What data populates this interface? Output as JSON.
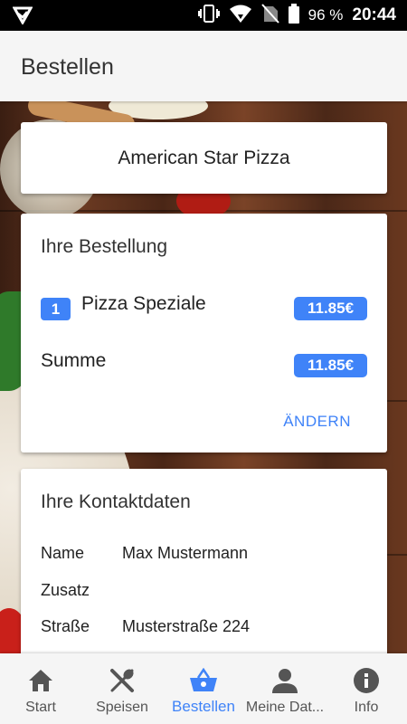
{
  "status_bar": {
    "battery_percent": "96 %",
    "time": "20:44",
    "icons": [
      "app-notification-icon",
      "vibrate-icon",
      "wifi-icon",
      "no-sim-icon",
      "battery-icon"
    ]
  },
  "app_bar": {
    "title": "Bestellen"
  },
  "restaurant": {
    "name": "American Star Pizza"
  },
  "order": {
    "heading": "Ihre Bestellung",
    "items": [
      {
        "quantity": "1",
        "name": "Pizza Speziale",
        "price": "11.85€"
      }
    ],
    "sum_label": "Summe",
    "sum_value": "11.85€",
    "change_label": "ÄNDERN"
  },
  "contact": {
    "heading": "Ihre Kontaktdaten",
    "rows": [
      {
        "label": "Name",
        "value": "Max Mustermann"
      },
      {
        "label": "Zusatz",
        "value": ""
      },
      {
        "label": "Straße",
        "value": "Musterstraße 224"
      }
    ]
  },
  "bottom_nav": {
    "items": [
      {
        "label": "Start",
        "icon": "home-icon",
        "active": false
      },
      {
        "label": "Speisen",
        "icon": "cutlery-icon",
        "active": false
      },
      {
        "label": "Bestellen",
        "icon": "basket-icon",
        "active": true
      },
      {
        "label": "Meine Dat...",
        "icon": "person-icon",
        "active": false
      },
      {
        "label": "Info",
        "icon": "info-icon",
        "active": false
      }
    ]
  },
  "colors": {
    "accent": "#3f83f8",
    "app_bar_bg": "#f5f5f5",
    "nav_icon": "#555555"
  }
}
